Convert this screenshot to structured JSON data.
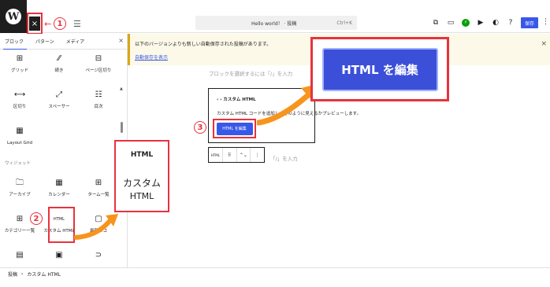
{
  "topbar": {
    "logo_letter": "W",
    "close_label": "×",
    "arrow": "←",
    "step1": "①",
    "list_icon": "☰",
    "doc_title": "Hello world！ · 投稿",
    "shortcut": "Ctrl+K",
    "icons": [
      "⧉",
      "▭",
      "⚡",
      "▶",
      "◐",
      "?"
    ],
    "save_label": "保存",
    "more": "⋮"
  },
  "sidebar": {
    "tabs": [
      "ブロック",
      "パターン",
      "メディア"
    ],
    "close": "×",
    "design_blocks": [
      {
        "icon": "⊞",
        "label": "グリッド"
      },
      {
        "icon": "⁄⁄",
        "label": "続き"
      },
      {
        "icon": "⊟",
        "label": "ページ区切り"
      },
      {
        "icon": "⟷",
        "label": "区切り"
      },
      {
        "icon": "⤢",
        "label": "スペーサー"
      },
      {
        "icon": "☷",
        "label": "目次"
      },
      {
        "icon": "▦",
        "label": "Layout Grid"
      }
    ],
    "widget_section": "ウィジェット",
    "widget_blocks": [
      {
        "icon": "🗀",
        "label": "アーカイブ"
      },
      {
        "icon": "▦",
        "label": "カレンダー"
      },
      {
        "icon": "⊞",
        "label": "ターム一覧"
      },
      {
        "icon": "⊞",
        "label": "カテゴリー一覧"
      },
      {
        "icon": "HTML",
        "label": "カスタム HTML"
      },
      {
        "icon": "▢",
        "label": "最新のコ"
      },
      {
        "icon": "▤",
        "label": ""
      },
      {
        "icon": "▣",
        "label": ""
      },
      {
        "icon": "⊃",
        "label": ""
      }
    ],
    "step2": "②"
  },
  "zoom": {
    "top": "HTML",
    "mid": "カスタム",
    "bottom": "HTML"
  },
  "notice": {
    "message": "以下のバージョンよりも新しい自動保存された投稿があります。",
    "link": "自動保存を表示",
    "close": "×"
  },
  "editor": {
    "placeholder": "ブロックを選択するには「/」を入力",
    "block_title": "‹ › カスタム HTML",
    "block_desc": "カスタム HTML コードを追加し、どのように見えるかプレビューします。",
    "edit_small": "HTML を編集",
    "step3": "③",
    "toolbar": [
      "HTML",
      "⠿",
      "⌃⌄",
      "⋮"
    ],
    "after_placeholder": "「/」を入力"
  },
  "callout": {
    "label": "HTML を編集"
  },
  "footer": {
    "crumbs": [
      "投稿",
      "›",
      "カスタム HTML"
    ]
  },
  "colors": {
    "accent": "#3858e9",
    "highlight": "#e8323c",
    "notice_border": "#dba617",
    "arrow_orange": "#f7941d"
  }
}
